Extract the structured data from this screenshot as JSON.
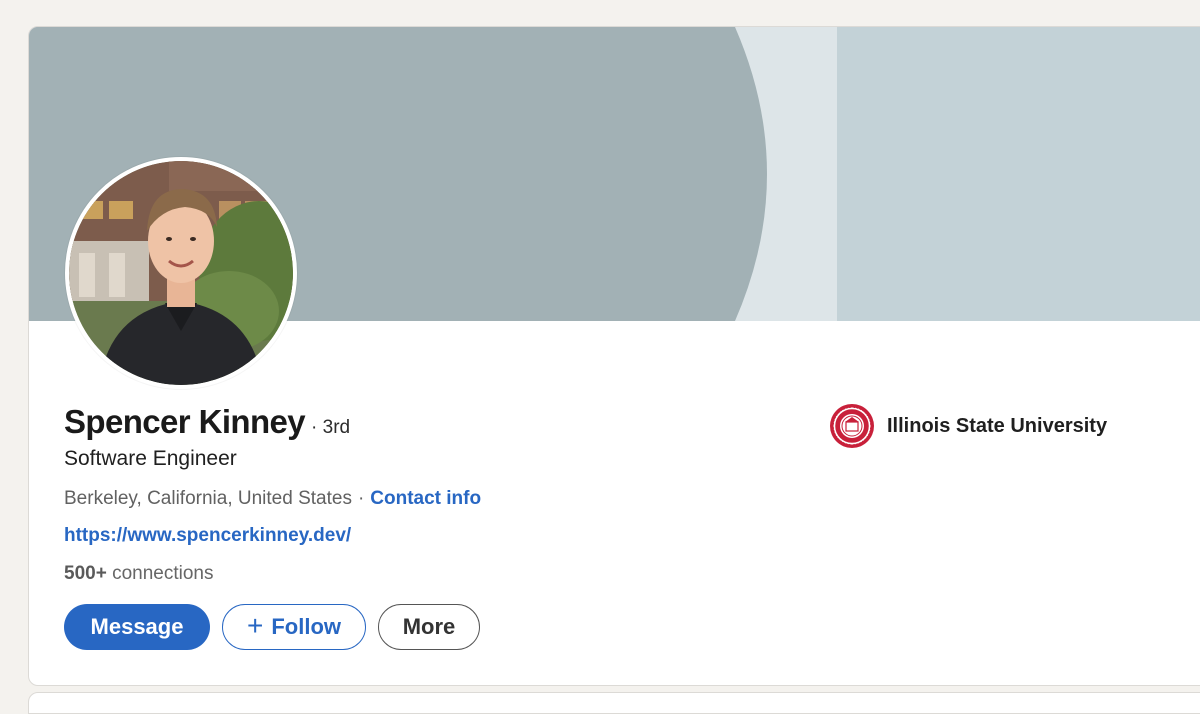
{
  "profile": {
    "name": "Spencer Kinney",
    "degree": "· 3rd",
    "headline": "Software Engineer",
    "location": "Berkeley, California, United States",
    "location_separator": "·",
    "contact_info_label": "Contact info",
    "website": "https://www.spencerkinney.dev/",
    "connections_count": "500+",
    "connections_label": "connections"
  },
  "education": {
    "school": "Illinois State University",
    "logo_icon": "university-seal-icon"
  },
  "actions": {
    "message_label": "Message",
    "follow_label": "Follow",
    "more_label": "More"
  },
  "colors": {
    "brand_blue": "#2867c3",
    "banner_left": "#a2b1b5",
    "banner_mid": "#dde5e8",
    "banner_right": "#c3d2d7",
    "seal_red": "#c8203a"
  }
}
